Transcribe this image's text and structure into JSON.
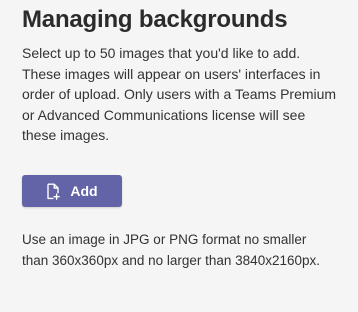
{
  "header": {
    "title": "Managing backgrounds"
  },
  "description": "Select up to 50 images that you'd like to add. These images will appear on users' interfaces in order of upload. Only users with a Teams Premium or Advanced Communications license will see these images.",
  "add_button": {
    "label": "Add",
    "icon": "file-add-icon",
    "color": "#6264a7"
  },
  "format_note": "Use an image in JPG or PNG format no smaller than 360x360px and no larger than 3840x2160px."
}
